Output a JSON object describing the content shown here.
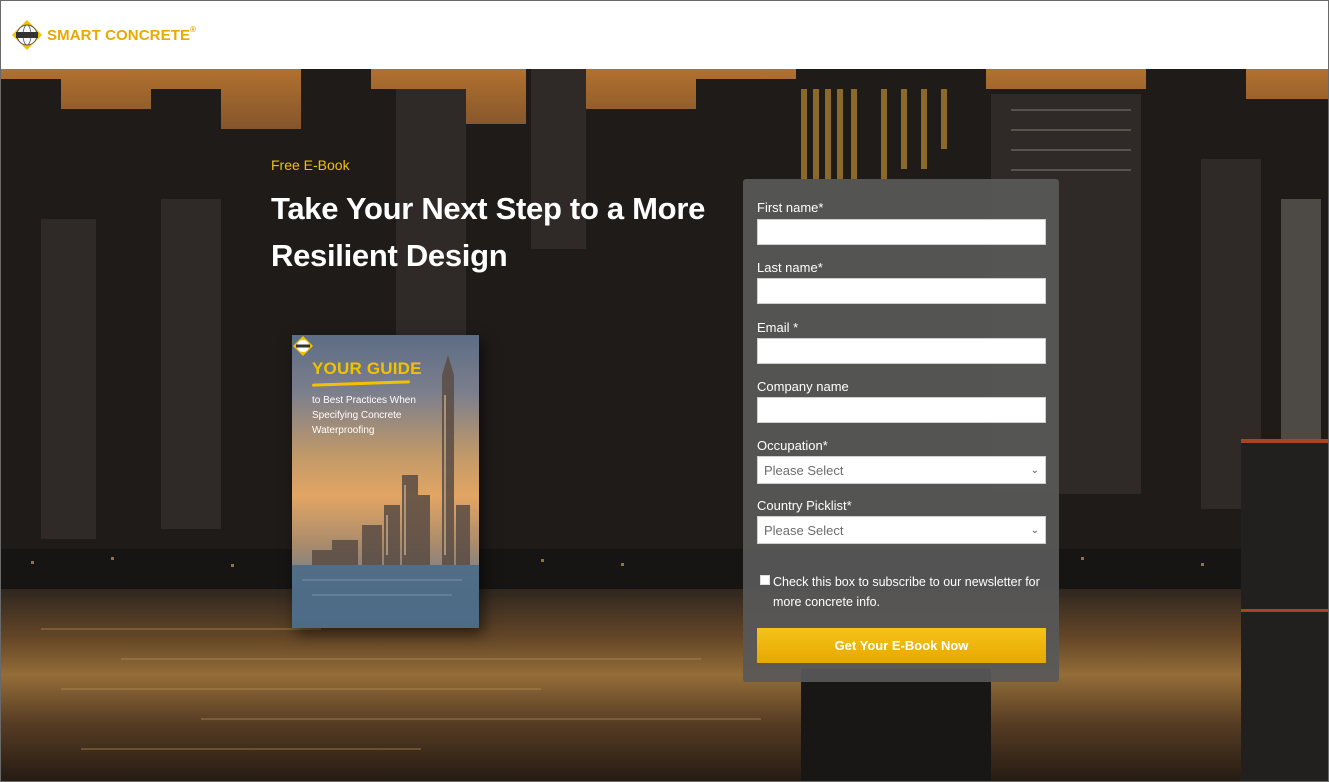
{
  "brand": {
    "name": "SMART CONCRETE",
    "mark": "®",
    "badge_text": "KRYTON",
    "color": "#e8a900"
  },
  "hero": {
    "eyebrow": "Free E-Book",
    "headline": "Take Your Next Step to a More Resilient Design"
  },
  "book": {
    "title": "YOUR GUIDE",
    "subtitle": "to Best Practices When Specifying Concrete Waterproofing"
  },
  "form": {
    "fields": [
      {
        "label": "First name*",
        "value": ""
      },
      {
        "label": "Last name*",
        "value": ""
      },
      {
        "label": "Email *",
        "value": ""
      },
      {
        "label": "Company name",
        "value": ""
      }
    ],
    "selects": [
      {
        "label": "Occupation*",
        "selected": "Please Select"
      },
      {
        "label": "Country Picklist*",
        "selected": "Please Select"
      }
    ],
    "newsletter": {
      "label": "Check this box to subscribe to our newsletter for more concrete info.",
      "checked": false
    },
    "submit_label": "Get Your E-Book Now",
    "accent": "#f2c200"
  }
}
